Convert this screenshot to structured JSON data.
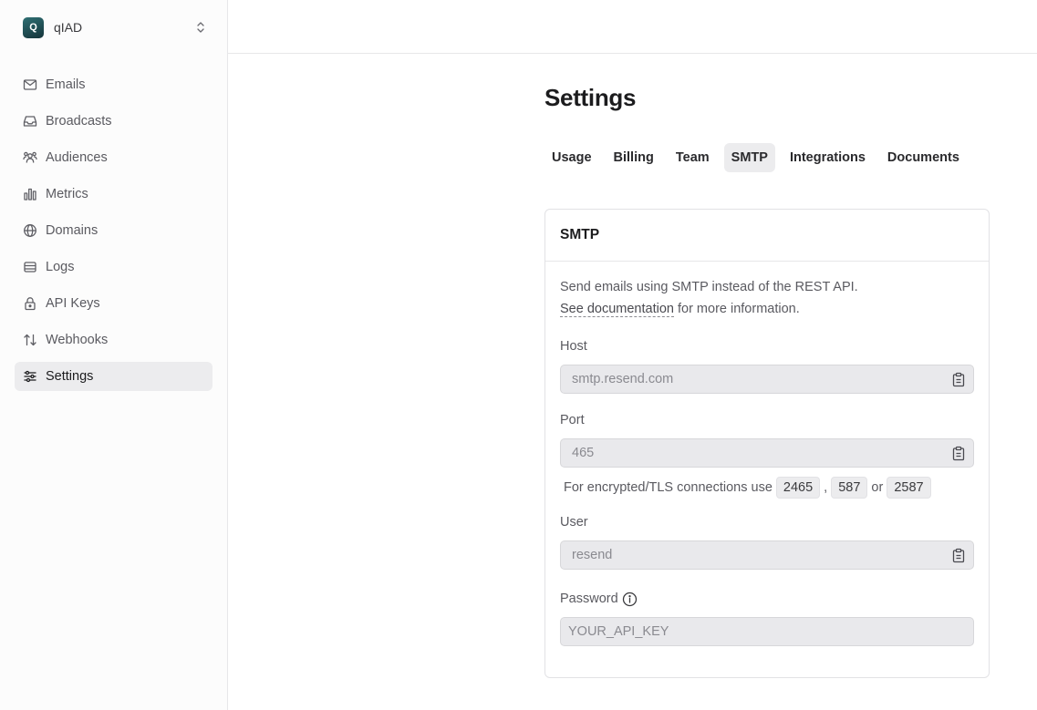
{
  "team": {
    "logo_letter": "Q",
    "name": "qIAD"
  },
  "sidebar": {
    "items": [
      {
        "label": "Emails",
        "icon": "mail-icon"
      },
      {
        "label": "Broadcasts",
        "icon": "inbox-icon"
      },
      {
        "label": "Audiences",
        "icon": "users-icon"
      },
      {
        "label": "Metrics",
        "icon": "bar-chart-icon"
      },
      {
        "label": "Domains",
        "icon": "globe-icon"
      },
      {
        "label": "Logs",
        "icon": "logs-icon"
      },
      {
        "label": "API Keys",
        "icon": "lock-icon"
      },
      {
        "label": "Webhooks",
        "icon": "arrows-up-down-icon"
      },
      {
        "label": "Settings",
        "icon": "sliders-icon",
        "active": true
      }
    ]
  },
  "page": {
    "title": "Settings"
  },
  "tabs": [
    {
      "label": "Usage"
    },
    {
      "label": "Billing"
    },
    {
      "label": "Team"
    },
    {
      "label": "SMTP",
      "active": true
    },
    {
      "label": "Integrations"
    },
    {
      "label": "Documents"
    }
  ],
  "smtp": {
    "title": "SMTP",
    "description": "Send emails using SMTP instead of the REST API.",
    "doc_link": "See documentation",
    "doc_suffix": " for more information.",
    "host": {
      "label": "Host",
      "value": "smtp.resend.com"
    },
    "port": {
      "label": "Port",
      "value": "465"
    },
    "port_hint": {
      "prefix": "For encrypted/TLS connections use",
      "ports": [
        "2465",
        "587",
        "2587"
      ],
      "comma": ",",
      "or": "or"
    },
    "user": {
      "label": "User",
      "value": "resend"
    },
    "password": {
      "label": "Password",
      "placeholder": "YOUR_API_KEY"
    }
  },
  "colors": {
    "active_bg": "#ececee",
    "field_bg": "#e9e9ec",
    "logo_gradient_start": "#2f6f73",
    "logo_gradient_end": "#15343a"
  }
}
